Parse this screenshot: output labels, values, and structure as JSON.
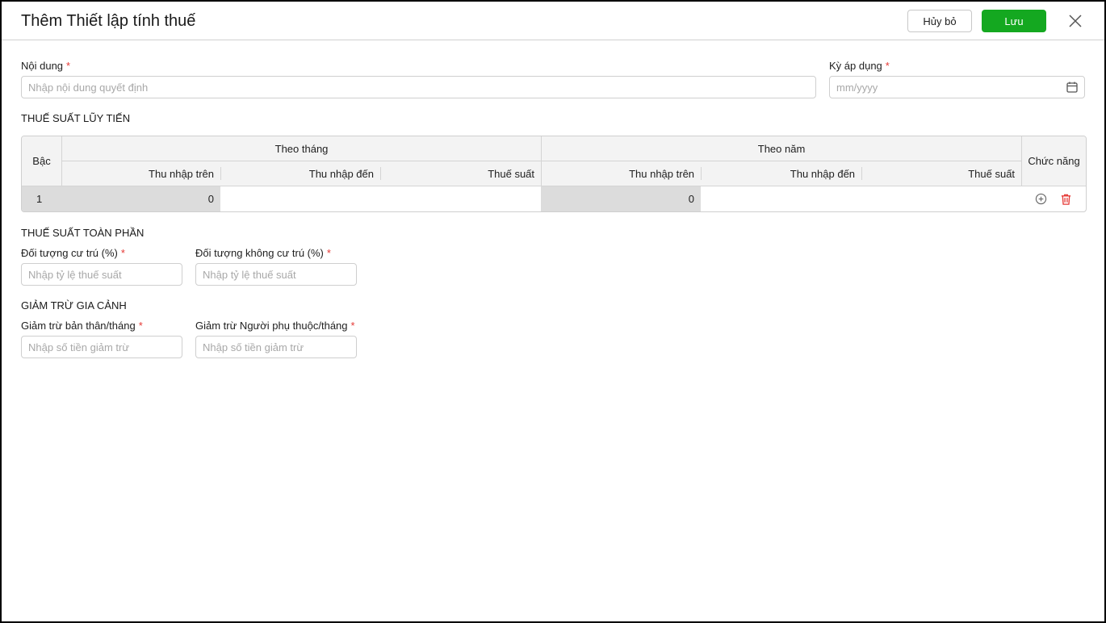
{
  "dialog": {
    "title": "Thêm Thiết lập tính thuế",
    "cancel_label": "Hủy bỏ",
    "save_label": "Lưu"
  },
  "form": {
    "noi_dung": {
      "label": "Nội dung",
      "required": "*",
      "placeholder": "Nhập nội dung quyết định",
      "value": ""
    },
    "ky_ap_dung": {
      "label": "Kỳ áp dụng",
      "required": "*",
      "placeholder": "mm/yyyy",
      "value": ""
    }
  },
  "progressive": {
    "title": "THUẾ SUẤT LŨY TIẾN",
    "headers": {
      "bac": "Bậc",
      "theo_thang": "Theo tháng",
      "theo_nam": "Theo năm",
      "chuc_nang": "Chức năng",
      "thu_nhap_tren": "Thu nhập trên",
      "thu_nhap_den": "Thu nhập đến",
      "thue_suat": "Thuế suất"
    },
    "rows": [
      {
        "bac": "1",
        "month_from": "0",
        "month_to": "",
        "month_rate": "",
        "year_from": "0",
        "year_to": "",
        "year_rate": ""
      }
    ]
  },
  "flat": {
    "title": "THUẾ SUẤT TOÀN PHẦN",
    "resident": {
      "label": "Đối tượng cư trú (%)",
      "required": "*",
      "placeholder": "Nhập tỷ lệ thuế suất"
    },
    "non_resident": {
      "label": "Đối tượng không cư trú (%)",
      "required": "*",
      "placeholder": "Nhập tỷ lệ thuế suất"
    }
  },
  "deduction": {
    "title": "GIẢM TRỪ GIA CẢNH",
    "self": {
      "label": "Giảm trừ bản thân/tháng",
      "required": "*",
      "placeholder": "Nhập số tiền giảm trừ"
    },
    "dependent": {
      "label": "Giảm trừ Người phụ thuộc/tháng",
      "required": "*",
      "placeholder": "Nhập số tiền giảm trừ"
    }
  },
  "colors": {
    "accent": "#14a820",
    "danger": "#e53935"
  }
}
